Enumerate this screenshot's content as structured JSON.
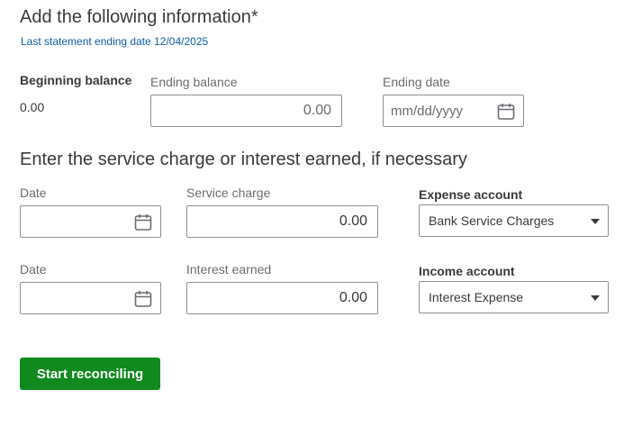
{
  "header": {
    "title": "Add the following information*",
    "subtitle": "Last statement ending date 12/04/2025"
  },
  "statement": {
    "beginning_balance_label": "Beginning balance",
    "beginning_balance_value": "0.00",
    "ending_balance_label": "Ending balance",
    "ending_balance_value": "0.00",
    "ending_date_label": "Ending date",
    "ending_date_placeholder": "mm/dd/yyyy"
  },
  "service_section": {
    "title": "Enter the service charge or interest earned, if necessary",
    "service_row": {
      "date_label": "Date",
      "date_value": "",
      "charge_label": "Service charge",
      "charge_value": "0.00",
      "account_label": "Expense account",
      "account_value": "Bank Service Charges"
    },
    "interest_row": {
      "date_label": "Date",
      "date_value": "",
      "interest_label": "Interest earned",
      "interest_value": "0.00",
      "account_label": "Income account",
      "account_value": "Interest Expense"
    }
  },
  "actions": {
    "start_label": "Start reconciling",
    "button_color": "#108a1e"
  },
  "icons": {
    "calendar": "calendar-icon",
    "dropdown": "chevron-down-icon"
  }
}
